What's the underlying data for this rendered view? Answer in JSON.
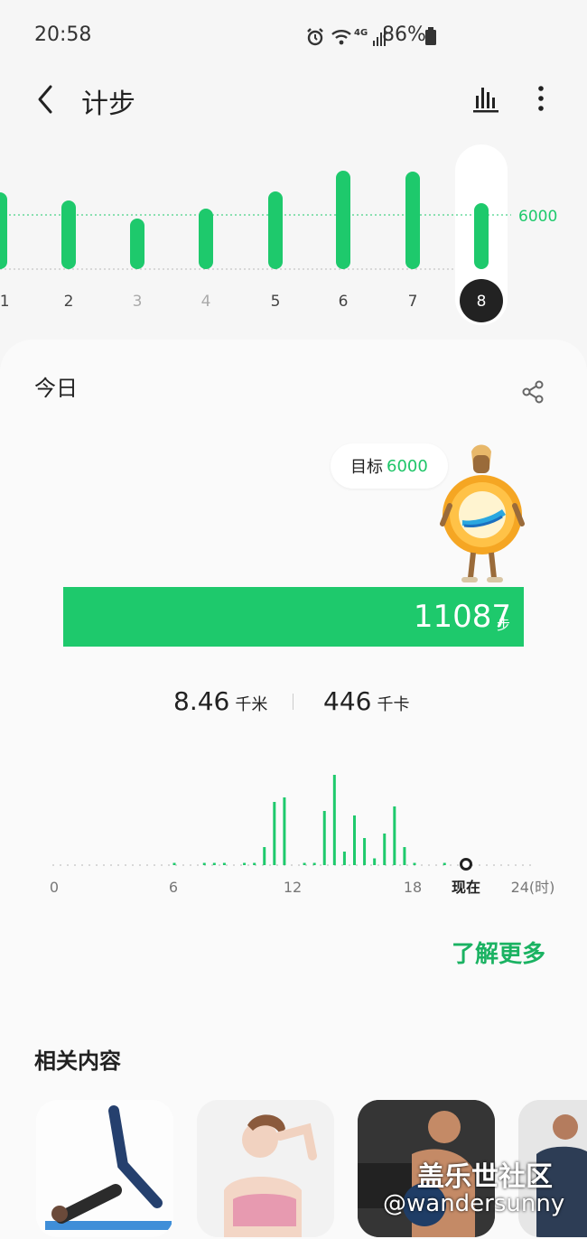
{
  "status_bar": {
    "time": "20:58",
    "network": "4G",
    "battery": "86%"
  },
  "header": {
    "title": "计步"
  },
  "week": {
    "goal_label": "6000",
    "days": [
      "/1",
      "2",
      "3",
      "4",
      "5",
      "6",
      "7",
      "8"
    ],
    "selected_day": "8"
  },
  "today": {
    "label": "今日",
    "goal_prefix": "目标",
    "goal_value": "6000",
    "steps": "11087",
    "steps_unit": "步",
    "distance": "8.46",
    "distance_unit": "千米",
    "calories": "446",
    "calories_unit": "千卡"
  },
  "hourly": {
    "ticks": [
      "0",
      "6",
      "12",
      "18",
      "现在",
      "24(时)"
    ]
  },
  "learn_more": "了解更多",
  "related": {
    "title": "相关内容"
  },
  "watermark": {
    "line1": "盖乐世社区",
    "line2": "@wandersunny"
  },
  "colors": {
    "accent": "#1ec96c",
    "link": "#1ab262"
  },
  "chart_data": [
    {
      "type": "bar",
      "categories": [
        "/1",
        "2",
        "3",
        "4",
        "5",
        "6",
        "7",
        "8"
      ],
      "values": [
        8500,
        7600,
        5600,
        6700,
        8600,
        10900,
        10800,
        7300
      ],
      "goal": 6000,
      "ylim": [
        0,
        11000
      ]
    },
    {
      "type": "bar",
      "x": [
        6,
        7.5,
        8,
        8.5,
        9.5,
        10,
        10.5,
        11,
        11.5,
        12.5,
        13,
        13.5,
        14,
        14.5,
        15,
        15.5,
        16,
        16.5,
        17,
        17.5,
        18,
        19.5
      ],
      "values": [
        0.5,
        0.5,
        0.5,
        0.5,
        0.5,
        0.5,
        4,
        14,
        15,
        0.5,
        0.5,
        12,
        20,
        3,
        11,
        6,
        1.5,
        7,
        13,
        4,
        0.5,
        0.5
      ],
      "xlim": [
        0,
        24
      ],
      "xticks": [
        "0",
        "6",
        "12",
        "18",
        "现在",
        "24(时)"
      ]
    }
  ]
}
